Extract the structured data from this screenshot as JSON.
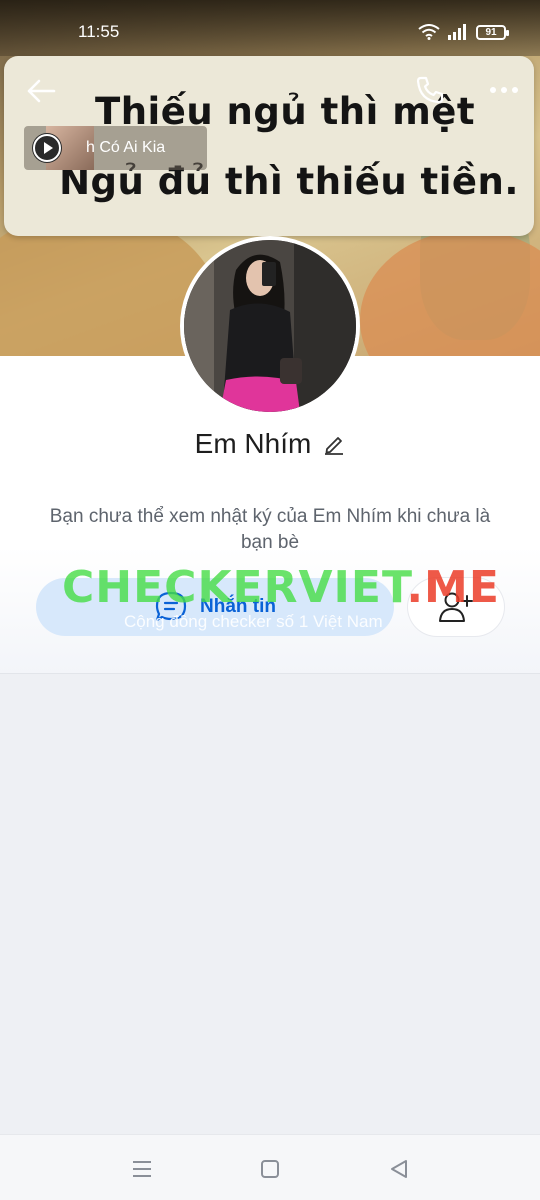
{
  "status": {
    "time": "11:55",
    "battery": "91"
  },
  "cover": {
    "line1": "Thiếu ngủ thì mệt",
    "line2": "Ngủ đủ thì thiếu tiền."
  },
  "music": {
    "title": "h Có Ai Kia"
  },
  "profile": {
    "name": "Em Nhím",
    "notice": "Bạn chưa thể xem nhật ký của Em Nhím khi chưa là bạn bè"
  },
  "actions": {
    "message_label": "Nhắn tin"
  },
  "watermark": {
    "main_green": "CHECKERVIET",
    "main_red": ".ME",
    "subtitle": "Cộng đồng checker số 1 Việt Nam"
  },
  "icons": {
    "back": "arrow-left-icon",
    "call": "phone-icon",
    "more": "more-dots-icon",
    "play": "play-icon",
    "edit": "pencil-icon",
    "chat": "chat-bubble-icon",
    "add_friend": "user-plus-icon"
  },
  "colors": {
    "accent": "#0a62d6",
    "message_bg": "#d7e8fb",
    "page_bg": "#eef0f4"
  }
}
